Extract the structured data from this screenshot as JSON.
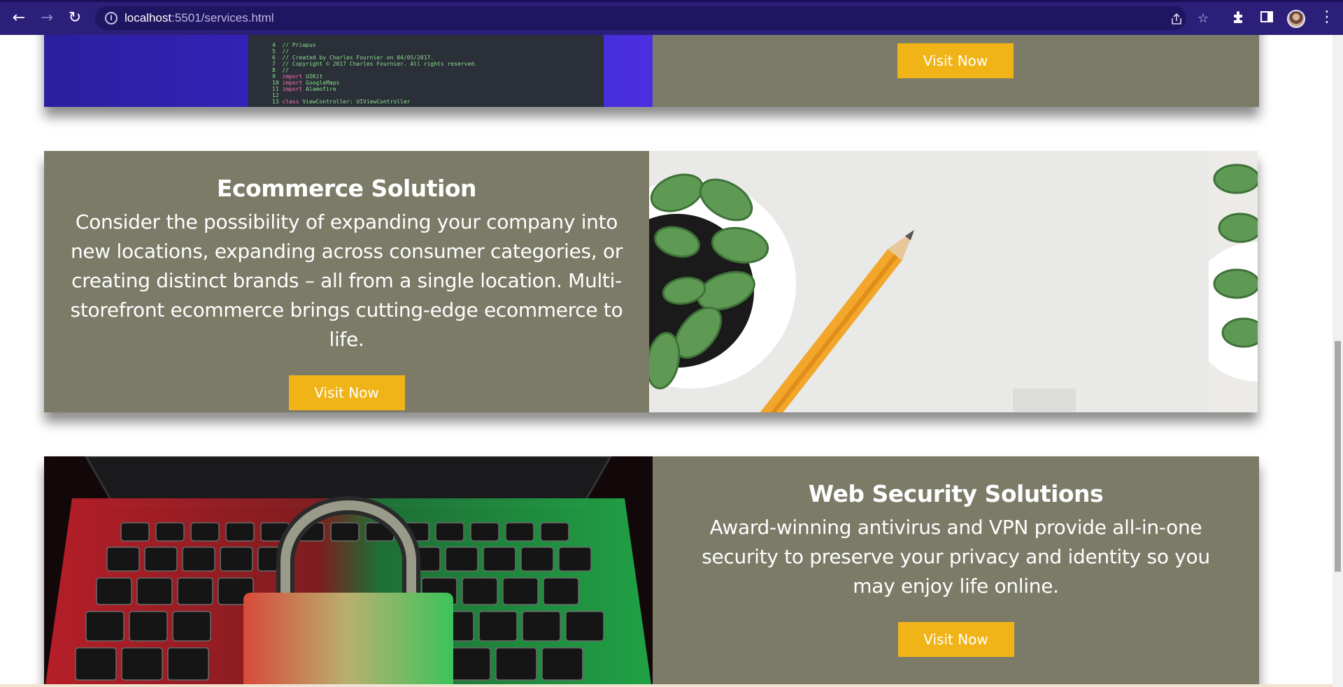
{
  "browser": {
    "url_host": "localhost",
    "url_rest": ":5501/services.html",
    "icons": {
      "back": "arrow-left-icon",
      "forward": "arrow-right-icon",
      "reload": "reload-icon",
      "site_info": "info-icon",
      "share": "share-icon",
      "bookmark": "star-icon",
      "extensions": "puzzle-icon",
      "side_panel": "side-panel-icon",
      "profile": "avatar",
      "menu": "kebab-menu-icon"
    }
  },
  "services": [
    {
      "title": "",
      "description": "",
      "button_label": "Visit Now"
    },
    {
      "title": "Ecommerce Solution",
      "description": "Consider the possibility of expanding your company into new locations, expanding across consumer categories, or creating distinct brands – all from a single location. Multi-storefront ecommerce brings cutting-edge ecommerce to life.",
      "button_label": "Visit Now"
    },
    {
      "title": "Web Security Solutions",
      "description": "Award-winning antivirus and VPN provide all-in-one security to preserve your privacy and identity so you may enjoy life online.",
      "button_label": "Visit Now"
    }
  ],
  "colors": {
    "chrome": "#2c1f7a",
    "panel": "#7b7b68",
    "button": "#f0b418"
  }
}
